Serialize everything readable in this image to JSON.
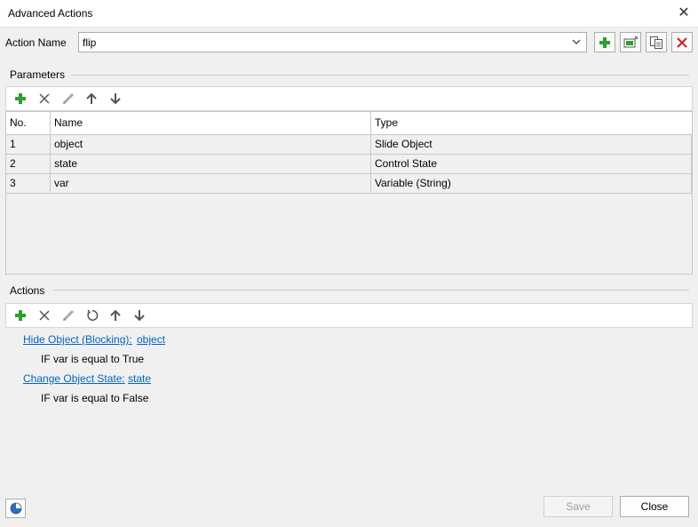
{
  "window": {
    "title": "Advanced Actions"
  },
  "action_name": {
    "label": "Action Name",
    "value": "flip"
  },
  "parameters": {
    "section_label": "Parameters",
    "columns": [
      "No.",
      "Name",
      "Type"
    ],
    "rows": [
      {
        "no": "1",
        "name": "object",
        "type": "Slide Object"
      },
      {
        "no": "2",
        "name": "state",
        "type": "Control State"
      },
      {
        "no": "3",
        "name": "var",
        "type": "Variable (String)"
      }
    ]
  },
  "actions": {
    "section_label": "Actions",
    "items": [
      {
        "action": "Hide Object (Blocking):",
        "target": "object",
        "condition": "IF var is equal to True"
      },
      {
        "action": "Change Object State:",
        "target": "state",
        "condition": "IF var is equal to False"
      }
    ]
  },
  "footer": {
    "save_label": "Save",
    "close_label": "Close"
  },
  "colors": {
    "add": "#2e9e2e",
    "delete": "#d42020",
    "link": "#0563c1"
  },
  "icons": {
    "top_toolbar": [
      "add-icon",
      "duplicate-icon",
      "copy-icon",
      "delete-icon"
    ],
    "params_toolbar": [
      "add-icon",
      "remove-icon",
      "edit-icon",
      "move-up-icon",
      "move-down-icon"
    ],
    "actions_toolbar": [
      "add-icon",
      "remove-icon",
      "edit-icon",
      "reset-icon",
      "move-up-icon",
      "move-down-icon"
    ],
    "footer": "usage-chart-icon"
  }
}
